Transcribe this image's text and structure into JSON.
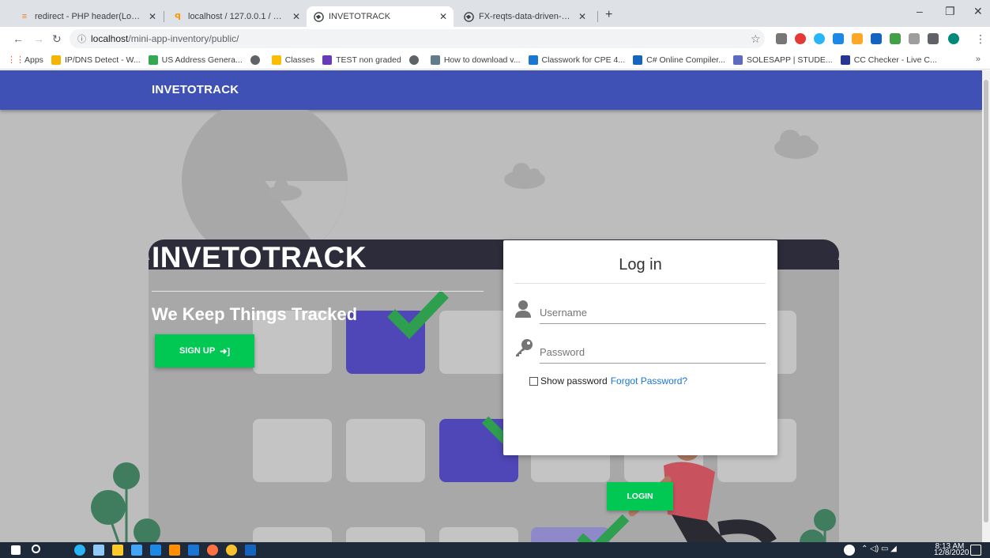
{
  "browser": {
    "tabs": [
      {
        "title": "redirect - PHP header(Location: ...",
        "icon": "stackoverflow-icon"
      },
      {
        "title": "localhost / 127.0.0.1 / miniapping...",
        "icon": "phpmyadmin-icon"
      },
      {
        "title": "INVETOTRACK",
        "icon": "globe-icon",
        "active": true
      },
      {
        "title": "FX-reqts-data-driven-apps.pdf",
        "icon": "globe-icon"
      }
    ],
    "url_host": "localhost",
    "url_path": "/mini-app-inventory/public/",
    "bookmarks": [
      {
        "label": "Apps",
        "color": "#e94235"
      },
      {
        "label": "IP/DNS Detect - W...",
        "color": "#f4b400"
      },
      {
        "label": "US Address Genera...",
        "color": "#34a853"
      },
      {
        "label": "",
        "color": "#5f6368"
      },
      {
        "label": "Classes",
        "color": "#fbbc04"
      },
      {
        "label": "TEST non graded",
        "color": "#673ab7"
      },
      {
        "label": "",
        "color": "#5f6368"
      },
      {
        "label": "How to download v...",
        "color": "#607d8b"
      },
      {
        "label": "Classwork for CPE 4...",
        "color": "#1976d2"
      },
      {
        "label": "C# Online Compiler...",
        "color": "#1565c0"
      },
      {
        "label": "SOLESAPP | STUDE...",
        "color": "#5c6bc0"
      },
      {
        "label": "CC Checker - Live C...",
        "color": "#283593"
      }
    ]
  },
  "app": {
    "brand": "INVETOTRACK",
    "hero_title": "INVETOTRACK",
    "hero_subtitle": "We Keep Things Tracked",
    "signup_label": "SIGN UP"
  },
  "login": {
    "title": "Log in",
    "username_placeholder": "Username",
    "password_placeholder": "Password",
    "show_password_label": "Show password",
    "forgot_label": "Forgot Password?",
    "login_label": "LOGIN"
  },
  "taskbar": {
    "time": "8:13 AM",
    "date": "12/8/2020"
  },
  "colors": {
    "navbar": "#3f51b5",
    "accent_green": "#00c853",
    "link": "#1976d2"
  }
}
